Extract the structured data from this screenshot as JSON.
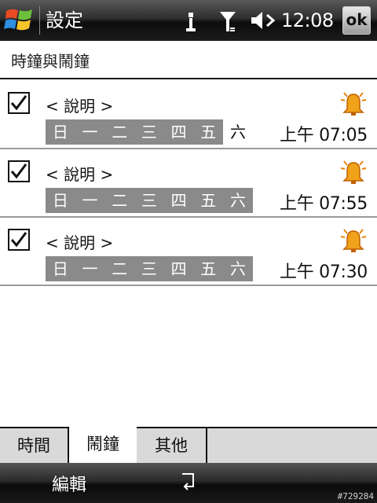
{
  "titlebar": {
    "title": "設定",
    "clock": "12:08",
    "ok_label": "ok"
  },
  "page": {
    "title": "時鐘與鬧鐘"
  },
  "alarms": [
    {
      "enabled": true,
      "description": "< 說明 >",
      "time": "上午 07:05",
      "days": [
        {
          "label": "日",
          "on": true
        },
        {
          "label": "一",
          "on": true
        },
        {
          "label": "二",
          "on": true
        },
        {
          "label": "三",
          "on": true
        },
        {
          "label": "四",
          "on": true
        },
        {
          "label": "五",
          "on": true
        },
        {
          "label": "六",
          "on": false
        }
      ]
    },
    {
      "enabled": true,
      "description": "< 說明 >",
      "time": "上午 07:55",
      "days": [
        {
          "label": "日",
          "on": true
        },
        {
          "label": "一",
          "on": true
        },
        {
          "label": "二",
          "on": true
        },
        {
          "label": "三",
          "on": true
        },
        {
          "label": "四",
          "on": true
        },
        {
          "label": "五",
          "on": true
        },
        {
          "label": "六",
          "on": true
        }
      ]
    },
    {
      "enabled": true,
      "description": "< 說明 >",
      "time": "上午 07:30",
      "days": [
        {
          "label": "日",
          "on": true
        },
        {
          "label": "一",
          "on": true
        },
        {
          "label": "二",
          "on": true
        },
        {
          "label": "三",
          "on": true
        },
        {
          "label": "四",
          "on": true
        },
        {
          "label": "五",
          "on": true
        },
        {
          "label": "六",
          "on": true
        }
      ]
    }
  ],
  "tabs": [
    {
      "label": "時間",
      "active": false
    },
    {
      "label": "鬧鐘",
      "active": true
    },
    {
      "label": "其他",
      "active": false
    }
  ],
  "softkeys": {
    "left": "編輯"
  },
  "footer_id": "#729284",
  "colors": {
    "selected_day_bg": "#8a8a8a",
    "bell": "#e8860c"
  }
}
